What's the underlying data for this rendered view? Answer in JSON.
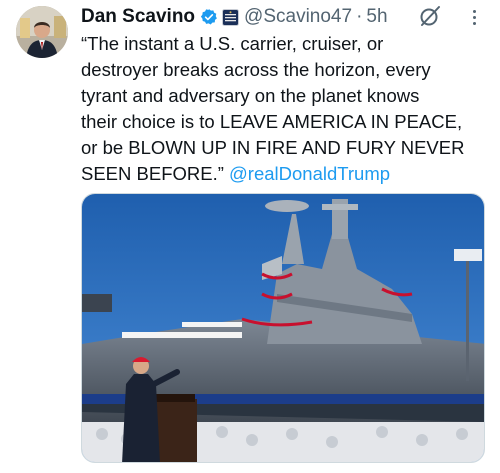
{
  "author": {
    "name": "Dan Scavino",
    "handle": "@Scavino47",
    "separator": "·",
    "timestamp": "5h",
    "verified_color": "#1d9bf0"
  },
  "tweet": {
    "lines": [
      "“The instant a U.S. carrier, cruiser, or",
      "destroyer breaks across the horizon, every",
      "tyrant and adversary on the planet knows",
      "their choice is to LEAVE AMERICA IN PEACE,",
      "or be BLOWN UP IN FIRE AND FURY NEVER"
    ],
    "last_line": "SEEN BEFORE.”",
    "mention": "@realDonaldTrump",
    "link_color": "#1d9bf0"
  },
  "icons": {
    "verified": "verified-check-icon",
    "affiliate": "affiliate-badge-icon",
    "grok": "grok-icon",
    "more": "more-options-icon"
  },
  "media": {
    "description_type": "photo"
  }
}
